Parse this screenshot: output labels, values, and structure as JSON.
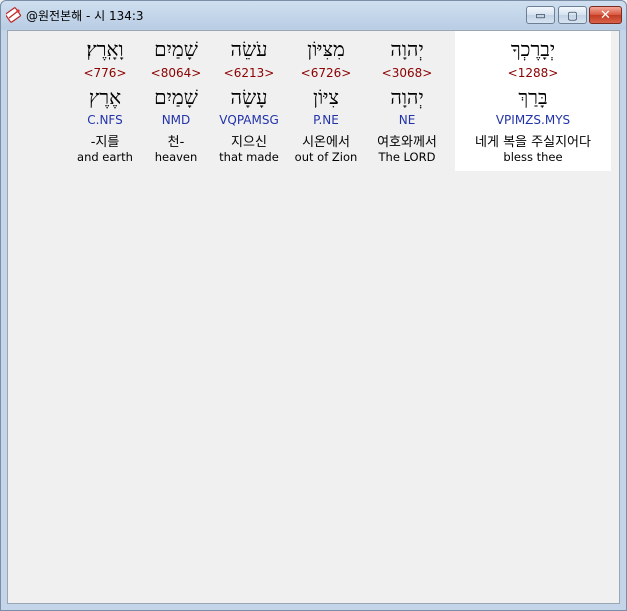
{
  "window": {
    "title": "@원전본해 - 시 134:3",
    "minimize_glyph": "▭",
    "maximize_glyph": "▢",
    "close_glyph": "✕"
  },
  "words": [
    {
      "hebrew": "וָאָֽרֶץ׃",
      "strong": "<776>",
      "lemma": "אֶרֶץ",
      "morph": "C.NFS",
      "korean": "-지를",
      "english": "and earth"
    },
    {
      "hebrew": "שָׁמַיִם",
      "strong": "<8064>",
      "lemma": "שָׁמַיִם",
      "morph": "NMD",
      "korean": "천-",
      "english": "heaven"
    },
    {
      "hebrew": "עֹשֵׂה",
      "strong": "<6213>",
      "lemma": "עָשָׂה",
      "morph": "VQPAMSG",
      "korean": "지으신",
      "english": "that made"
    },
    {
      "hebrew": "מִצִּיּוֹן",
      "strong": "<6726>",
      "lemma": "צִיּוֹן",
      "morph": "P.NE",
      "korean": "시온에서",
      "english": "out of Zion"
    },
    {
      "hebrew": "יְהוָה",
      "strong": "<3068>",
      "lemma": "יְהוָה",
      "morph": "NE",
      "korean": "여호와께서",
      "english": "The LORD"
    },
    {
      "hebrew": "יְבָרֶכְךָ",
      "strong": "<1288>",
      "lemma": "בָּרַךְ",
      "morph": "VPIMZS.MYS",
      "korean": "네게 복을 주실지어다",
      "english": "bless thee"
    }
  ],
  "colors": {
    "strong": "#8b0000",
    "morph": "#2233aa",
    "selected_background": "#ffffff"
  }
}
